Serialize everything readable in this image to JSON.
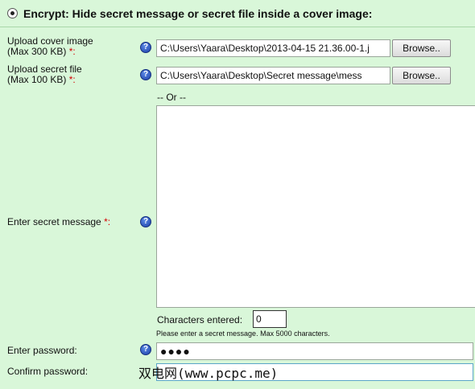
{
  "header": {
    "title": "Encrypt: Hide secret message or secret file inside a cover image:"
  },
  "cover_image": {
    "label": "Upload cover image",
    "sub_label": "(Max 300 KB)",
    "required": "*:",
    "value": "C:\\Users\\Yaara\\Desktop\\2013-04-15 21.36.00-1.j",
    "browse_label": "Browse..",
    "help_icon": "?"
  },
  "secret_file": {
    "label": "Upload secret file",
    "sub_label": "(Max 100 KB)",
    "required": "*:",
    "value": "C:\\Users\\Yaara\\Desktop\\Secret message\\mess",
    "browse_label": "Browse..",
    "help_icon": "?"
  },
  "or_text": "-- Or --",
  "secret_message": {
    "label": "Enter secret message",
    "required": "*:",
    "value": "",
    "help_icon": "?"
  },
  "characters": {
    "label": "Characters entered:",
    "value": "0",
    "hint": "Please enter a secret message. Max 5000 characters."
  },
  "password": {
    "label": "Enter password:",
    "value": "●●●●",
    "help_icon": "?"
  },
  "confirm_password": {
    "label": "Confirm password:",
    "value": ""
  },
  "watermark": "双电网(www.pcpc.me)"
}
